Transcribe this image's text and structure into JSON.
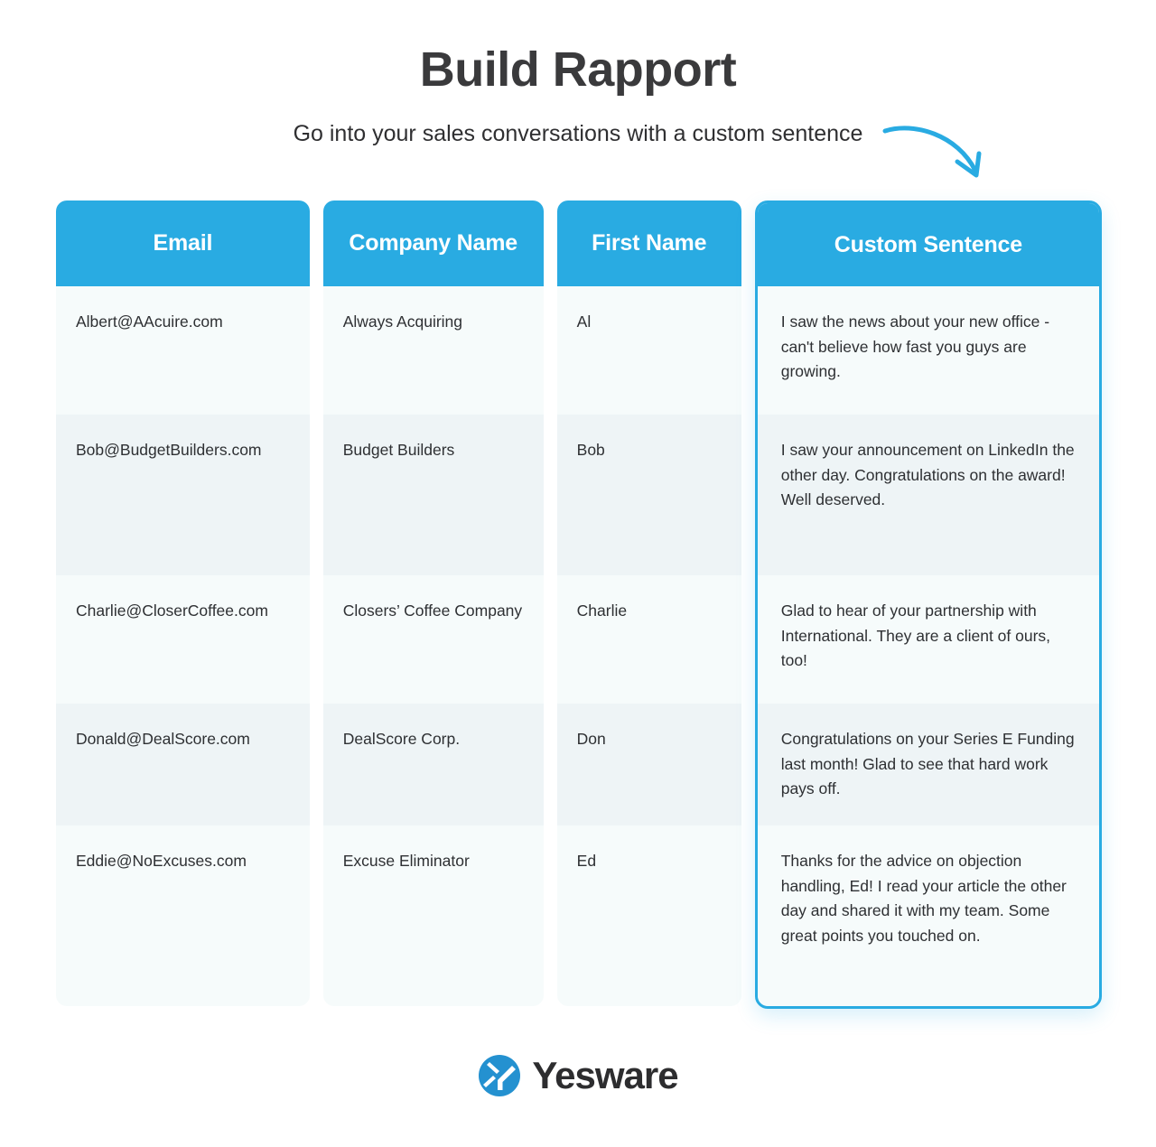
{
  "header": {
    "title": "Build Rapport",
    "subtitle": "Go into your sales conversations with a custom sentence",
    "arrow_icon": "curved-arrow-down-right-icon",
    "arrow_color": "#29abe2"
  },
  "theme": {
    "accent": "#29abe2",
    "header_text": "#ffffff",
    "row_bg_odd": "#f6fbfb",
    "row_bg_even": "#eef4f6",
    "body_text": "#2e3033",
    "title_color": "#3a3a3c"
  },
  "table": {
    "columns": [
      {
        "key": "email",
        "label": "Email",
        "highlighted": false
      },
      {
        "key": "company",
        "label": "Company Name",
        "highlighted": false
      },
      {
        "key": "first_name",
        "label": "First Name",
        "highlighted": false
      },
      {
        "key": "custom_sentence",
        "label": "Custom Sentence",
        "highlighted": true
      }
    ],
    "rows": [
      {
        "email": "Albert@AAcuire.com",
        "company": "Always Acquiring",
        "first_name": "Al",
        "custom_sentence": "I saw the news about your new office - can't believe how fast you guys are growing."
      },
      {
        "email": "Bob@BudgetBuilders.com",
        "company": "Budget Builders",
        "first_name": "Bob",
        "custom_sentence": "I saw your announcement on LinkedIn the other day. Congratulations on the award! Well deserved."
      },
      {
        "email": "Charlie@CloserCoffee.com",
        "company": "Closers’ Coffee Company",
        "first_name": "Charlie",
        "custom_sentence": "Glad to hear of your partnership with International. They are a client of ours, too!"
      },
      {
        "email": "Donald@DealScore.com",
        "company": "DealScore Corp.",
        "first_name": "Don",
        "custom_sentence": "Congratulations on your Series E Funding last month! Glad to see that hard work pays off."
      },
      {
        "email": "Eddie@NoExcuses.com",
        "company": "Excuse Eliminator",
        "first_name": "Ed",
        "custom_sentence": "Thanks for the advice on objection handling, Ed! I read your article the other day and shared it with my team. Some great points you touched on."
      }
    ]
  },
  "footer": {
    "brand": "Yesware",
    "logo_icon": "yesware-logo-icon",
    "logo_color": "#2491d0"
  }
}
